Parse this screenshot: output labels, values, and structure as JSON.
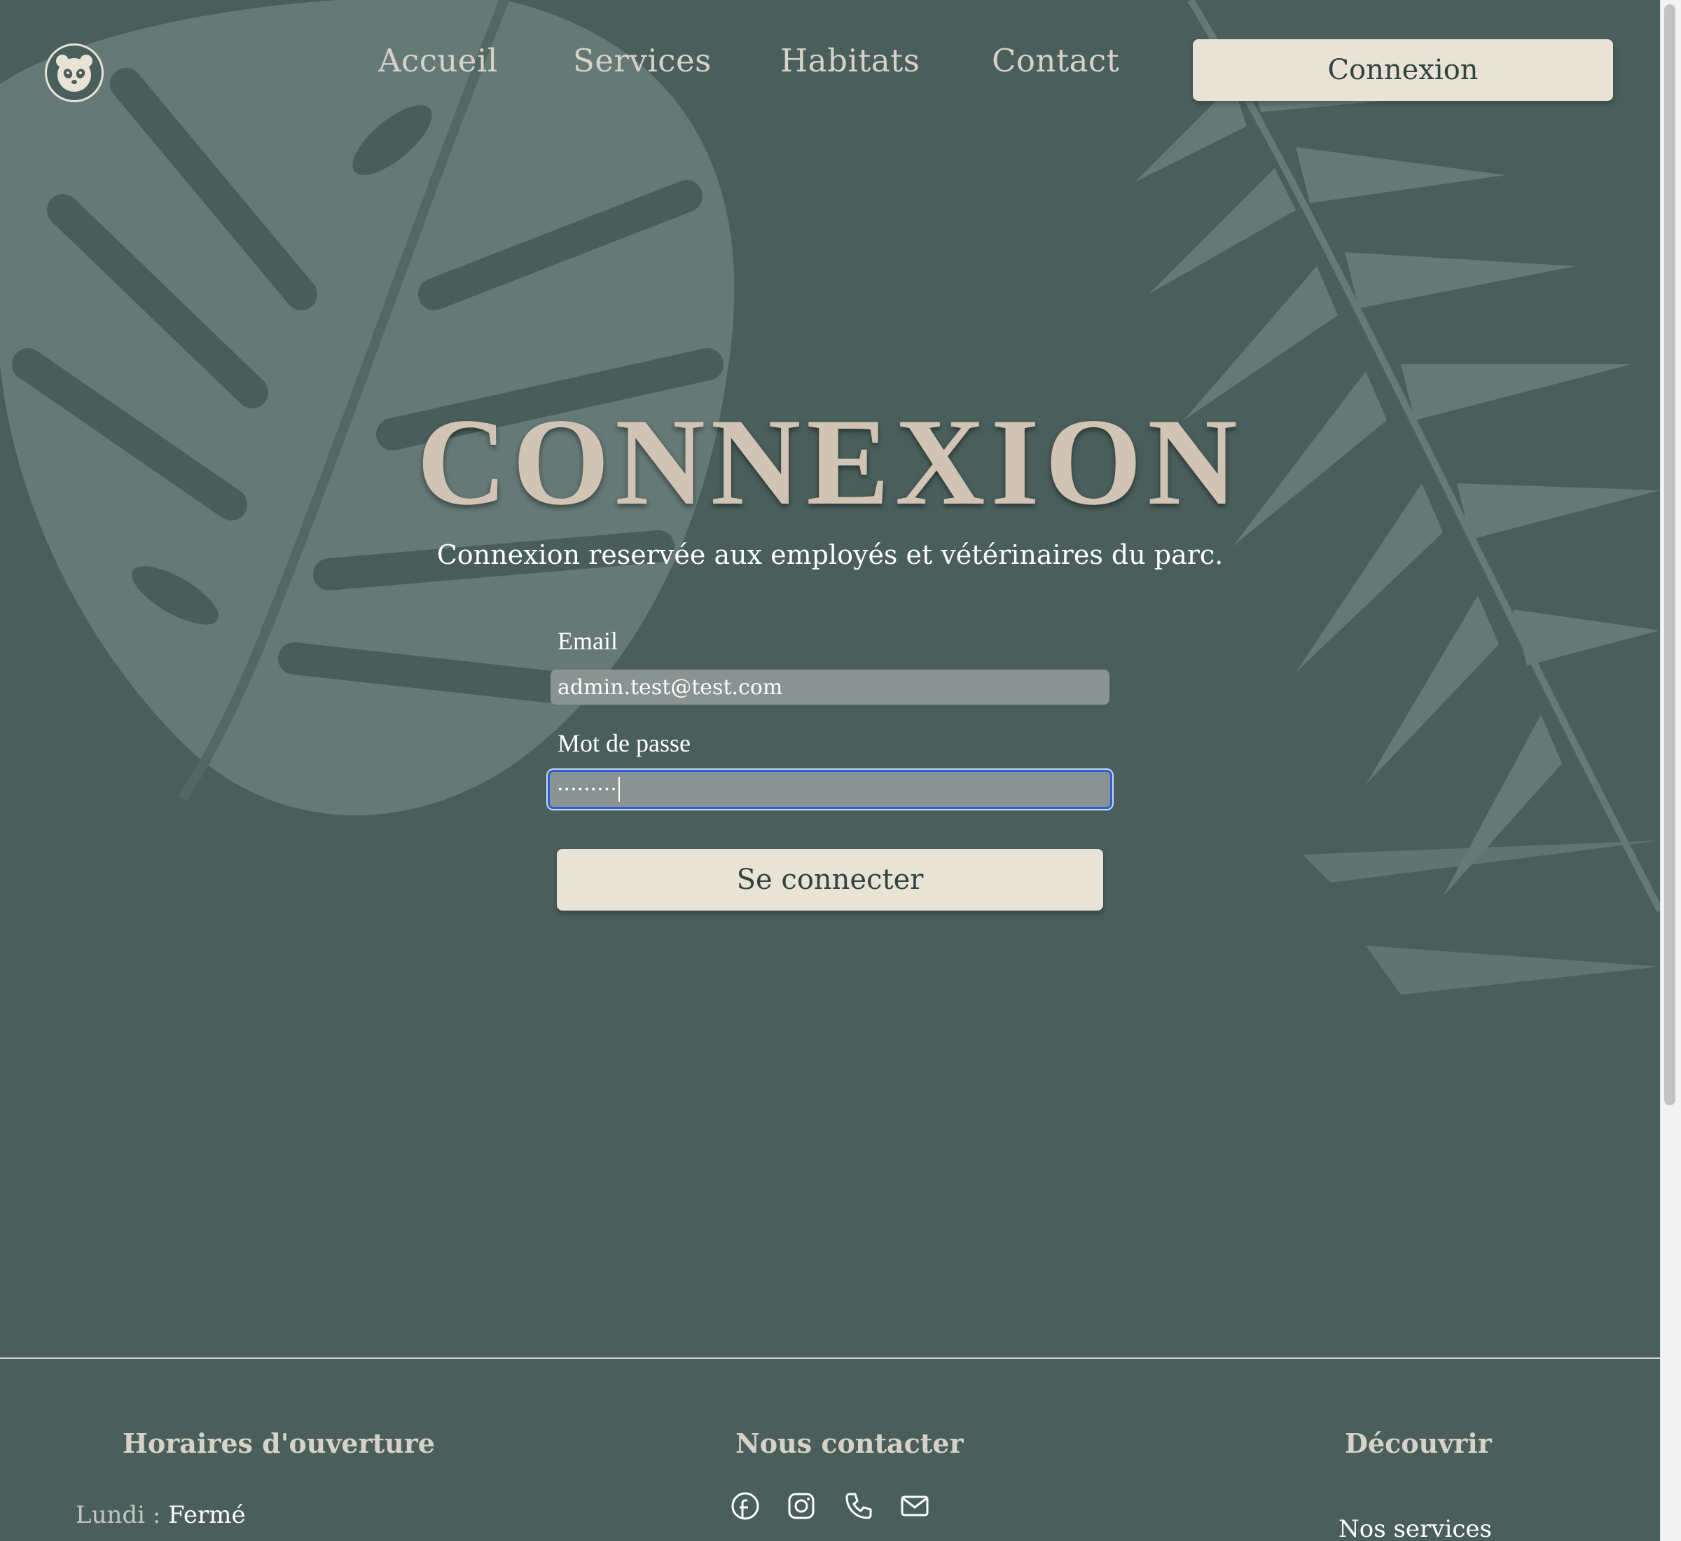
{
  "nav": {
    "links": [
      "Accueil",
      "Services",
      "Habitats",
      "Contact"
    ],
    "login_label": "Connexion",
    "logo_icon": "panda-icon"
  },
  "main": {
    "title": "CONNEXION",
    "subtitle": "Connexion reservée aux employés et vétérinaires du parc.",
    "email_label": "Email",
    "email_value": "admin.test@test.com",
    "password_label": "Mot de passe",
    "password_value": "·········",
    "submit_label": "Se connecter"
  },
  "footer": {
    "hours_heading": "Horaires d'ouverture",
    "hours": [
      {
        "day": "Lundi :",
        "value": "Fermé"
      }
    ],
    "contact_heading": "Nous contacter",
    "social_icons": [
      "facebook-icon",
      "instagram-icon",
      "phone-icon",
      "mail-icon"
    ],
    "discover_heading": "Découvrir",
    "discover_links": [
      "Nos services"
    ]
  },
  "colors": {
    "background": "#4a5f5b",
    "accent": "#e9e3d5",
    "title": "#d2c4b4",
    "focus_ring": "#2c5fd1"
  }
}
